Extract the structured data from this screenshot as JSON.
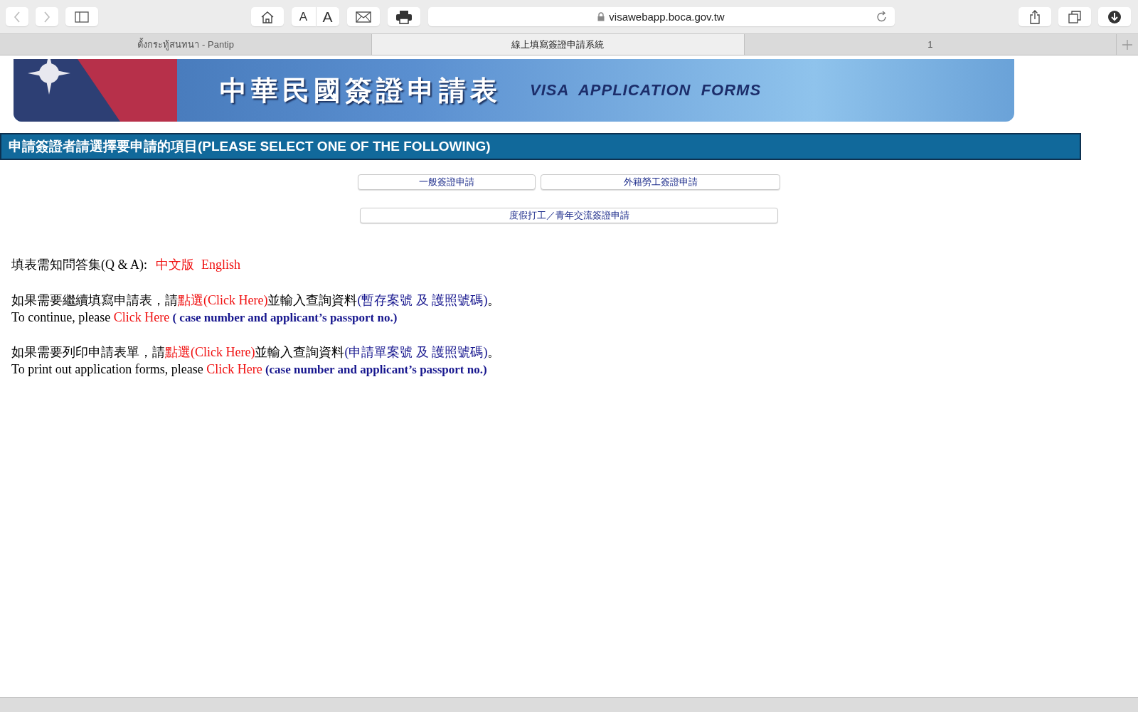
{
  "toolbar": {
    "address": "visawebapp.boca.gov.tw",
    "font_small": "A",
    "font_large": "A"
  },
  "tabs": [
    {
      "label": "ตั้งกระทู้สนทนา - Pantip",
      "selected": false
    },
    {
      "label": "線上填寫簽證申請系統",
      "selected": true
    },
    {
      "label": "1",
      "selected": false
    }
  ],
  "banner": {
    "title_zh": "中華民國簽證申請表",
    "title_en": "VISA  APPLICATION  FORMS"
  },
  "section_header": "申請簽證者請選擇要申請的項目(PLEASE SELECT ONE OF THE FOLLOWING)",
  "buttons": [
    [
      "一般簽證申請",
      "外籍勞工簽證申請"
    ],
    [
      "度假打工／青年交流簽證申請"
    ]
  ],
  "qa": {
    "label": "填表需知問答集(Q & A):",
    "links": [
      "中文版",
      "English"
    ]
  },
  "paragraphs": [
    [
      [
        {
          "kind": "text",
          "text": "如果需要繼續填寫申請表，請"
        },
        {
          "kind": "link",
          "text": "點選(Click Here)"
        },
        {
          "kind": "text",
          "text": "並輸入查詢資料"
        },
        {
          "kind": "note",
          "text": "(暫存案號 及 護照號碼)"
        },
        {
          "kind": "text",
          "text": "。"
        }
      ],
      [
        {
          "kind": "text",
          "text": "To continue, please "
        },
        {
          "kind": "link",
          "text": "Click Here"
        },
        {
          "kind": "note",
          "text": " ( case number and applicant’s passport no.)"
        }
      ]
    ],
    [
      [
        {
          "kind": "text",
          "text": "如果需要列印申請表單，請"
        },
        {
          "kind": "link",
          "text": "點選(Click Here)"
        },
        {
          "kind": "text",
          "text": "並輸入查詢資料"
        },
        {
          "kind": "note",
          "text": "(申請單案號 及 護照號碼)"
        },
        {
          "kind": "text",
          "text": "。"
        }
      ],
      [
        {
          "kind": "text",
          "text": "To print out application forms, please "
        },
        {
          "kind": "link",
          "text": "Click Here"
        },
        {
          "kind": "note",
          "text": " (case number and applicant’s passport no.)"
        }
      ]
    ]
  ]
}
